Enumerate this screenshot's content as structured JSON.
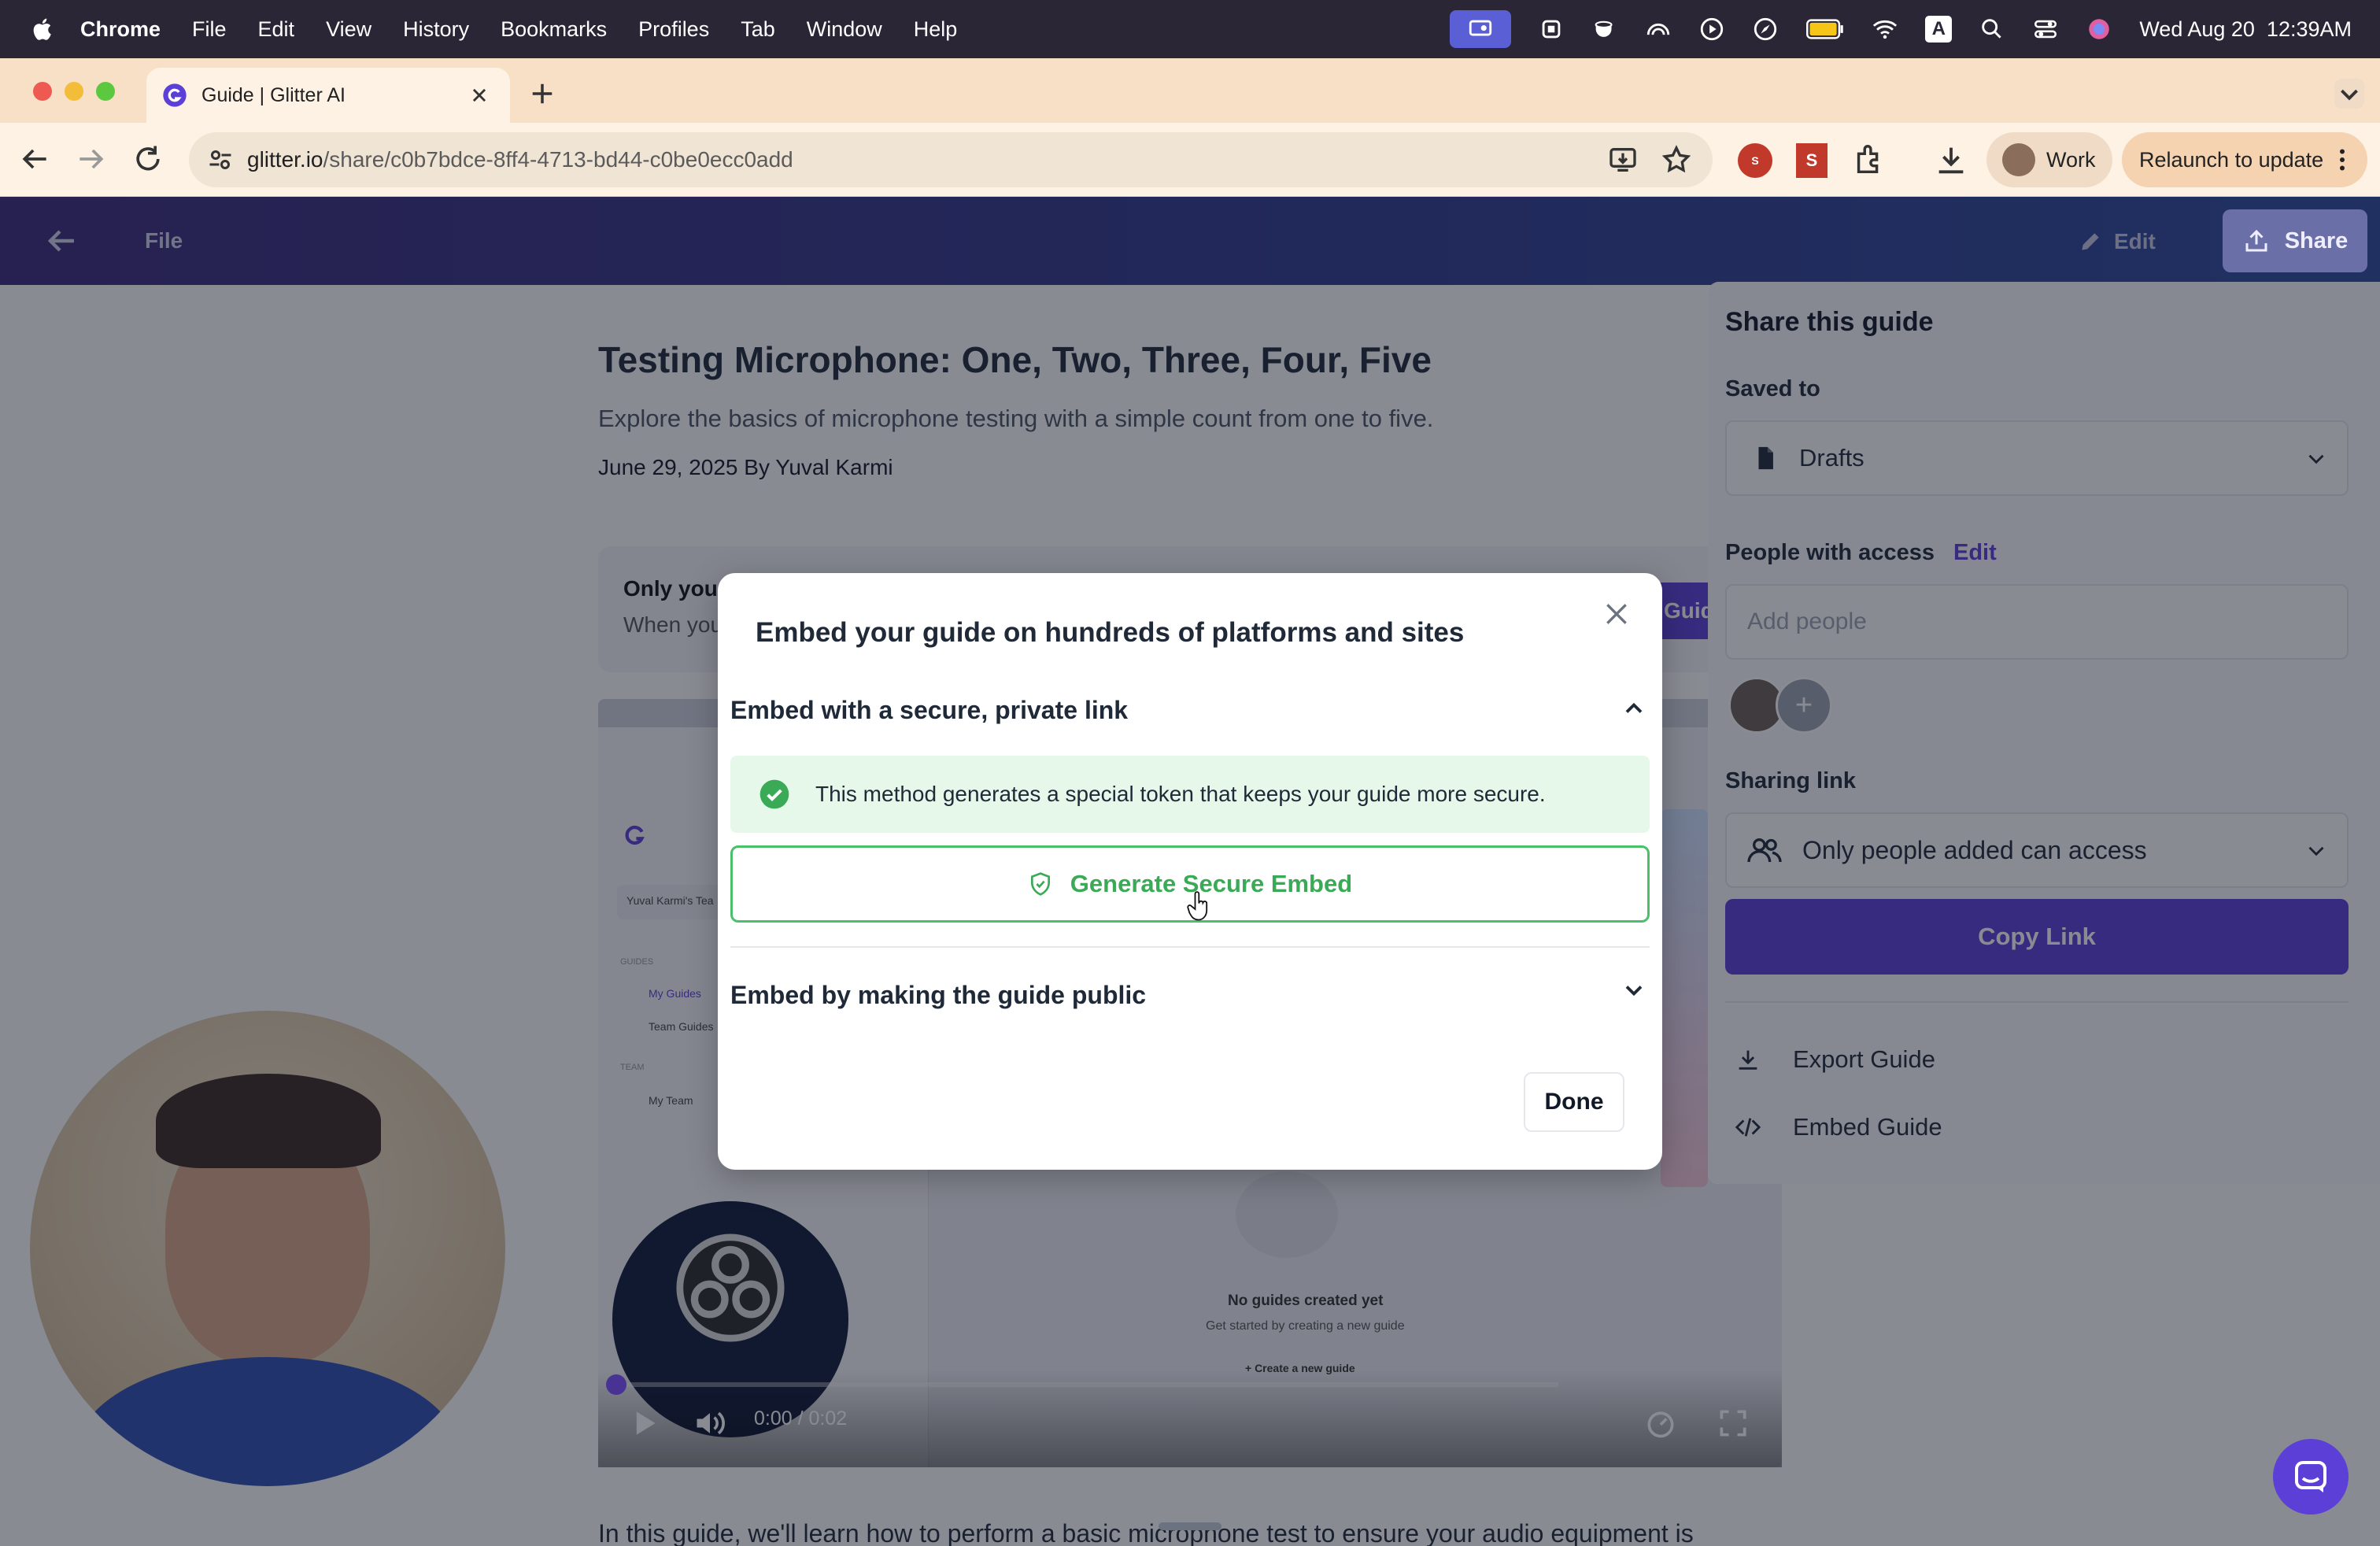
{
  "menubar": {
    "app": "Chrome",
    "items": [
      "File",
      "Edit",
      "View",
      "History",
      "Bookmarks",
      "Profiles",
      "Tab",
      "Window",
      "Help"
    ],
    "datetime": "Wed Aug 20  12:39AM",
    "keyboard_indicator": "A"
  },
  "browser": {
    "tab_title": "Guide | Glitter AI",
    "url_host": "glitter.io",
    "url_path": "/share/c0b7bdce-8ff4-4713-bd44-c0be0ecc0add",
    "profile_label": "Work",
    "relaunch_label": "Relaunch to update"
  },
  "app_header": {
    "file_label": "File",
    "edit_label": "Edit",
    "share_label": "Share"
  },
  "guide": {
    "title": "Testing Microphone: One, Two, Three, Four, Five",
    "subtitle": "Explore the basics of microphone testing with a simple count from one to five.",
    "meta": "June 29, 2025 By Yuval Karmi",
    "notice_title": "Only you",
    "notice_body": "When you",
    "notice_button": "Guid",
    "paragraph": "In this guide, we'll learn how to perform a basic microphone test to ensure your audio equipment is"
  },
  "video": {
    "time": "0:00 / 0:02",
    "empty_title": "No guides created yet",
    "empty_sub": "Get started by creating a new guide",
    "empty_create": "+  Create a new guide",
    "side_team": "Yuval Karmi's Tea",
    "side_my_guides": "My Guides",
    "side_team_guides": "Team Guides",
    "side_my_team": "My Team",
    "side_guides_heading": "GUIDES",
    "side_team_heading": "TEAM"
  },
  "share_panel": {
    "title": "Share this guide",
    "saved_to_label": "Saved to",
    "saved_to_value": "Drafts",
    "people_label": "People with access",
    "people_edit": "Edit",
    "add_people_placeholder": "Add people",
    "sharing_link_label": "Sharing link",
    "sharing_link_value": "Only people added can access",
    "copy_link": "Copy Link",
    "export_guide": "Export Guide",
    "embed_guide": "Embed Guide"
  },
  "modal": {
    "title": "Embed your guide on hundreds of platforms and sites",
    "section1_title": "Embed with a secure, private link",
    "info_text": "This method generates a special token that keeps your guide more secure.",
    "generate_button": "Generate Secure Embed",
    "section2_title": "Embed by making the guide public",
    "done_button": "Done"
  },
  "colors": {
    "accent": "#5b3fd6",
    "success": "#3aaa57",
    "success_bg": "#e6f8ea"
  }
}
